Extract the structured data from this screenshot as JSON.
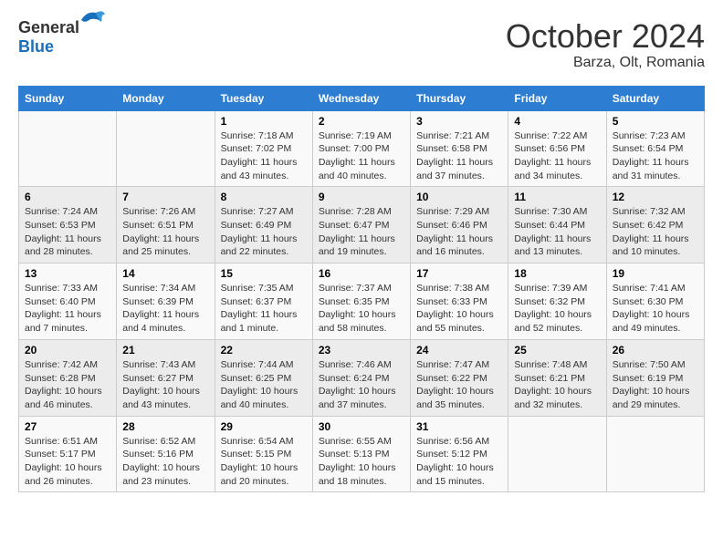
{
  "header": {
    "logo_general": "General",
    "logo_blue": "Blue",
    "month_year": "October 2024",
    "location": "Barza, Olt, Romania"
  },
  "days_of_week": [
    "Sunday",
    "Monday",
    "Tuesday",
    "Wednesday",
    "Thursday",
    "Friday",
    "Saturday"
  ],
  "weeks": [
    [
      {
        "day": "",
        "detail": ""
      },
      {
        "day": "",
        "detail": ""
      },
      {
        "day": "1",
        "detail": "Sunrise: 7:18 AM\nSunset: 7:02 PM\nDaylight: 11 hours and 43 minutes."
      },
      {
        "day": "2",
        "detail": "Sunrise: 7:19 AM\nSunset: 7:00 PM\nDaylight: 11 hours and 40 minutes."
      },
      {
        "day": "3",
        "detail": "Sunrise: 7:21 AM\nSunset: 6:58 PM\nDaylight: 11 hours and 37 minutes."
      },
      {
        "day": "4",
        "detail": "Sunrise: 7:22 AM\nSunset: 6:56 PM\nDaylight: 11 hours and 34 minutes."
      },
      {
        "day": "5",
        "detail": "Sunrise: 7:23 AM\nSunset: 6:54 PM\nDaylight: 11 hours and 31 minutes."
      }
    ],
    [
      {
        "day": "6",
        "detail": "Sunrise: 7:24 AM\nSunset: 6:53 PM\nDaylight: 11 hours and 28 minutes."
      },
      {
        "day": "7",
        "detail": "Sunrise: 7:26 AM\nSunset: 6:51 PM\nDaylight: 11 hours and 25 minutes."
      },
      {
        "day": "8",
        "detail": "Sunrise: 7:27 AM\nSunset: 6:49 PM\nDaylight: 11 hours and 22 minutes."
      },
      {
        "day": "9",
        "detail": "Sunrise: 7:28 AM\nSunset: 6:47 PM\nDaylight: 11 hours and 19 minutes."
      },
      {
        "day": "10",
        "detail": "Sunrise: 7:29 AM\nSunset: 6:46 PM\nDaylight: 11 hours and 16 minutes."
      },
      {
        "day": "11",
        "detail": "Sunrise: 7:30 AM\nSunset: 6:44 PM\nDaylight: 11 hours and 13 minutes."
      },
      {
        "day": "12",
        "detail": "Sunrise: 7:32 AM\nSunset: 6:42 PM\nDaylight: 11 hours and 10 minutes."
      }
    ],
    [
      {
        "day": "13",
        "detail": "Sunrise: 7:33 AM\nSunset: 6:40 PM\nDaylight: 11 hours and 7 minutes."
      },
      {
        "day": "14",
        "detail": "Sunrise: 7:34 AM\nSunset: 6:39 PM\nDaylight: 11 hours and 4 minutes."
      },
      {
        "day": "15",
        "detail": "Sunrise: 7:35 AM\nSunset: 6:37 PM\nDaylight: 11 hours and 1 minute."
      },
      {
        "day": "16",
        "detail": "Sunrise: 7:37 AM\nSunset: 6:35 PM\nDaylight: 10 hours and 58 minutes."
      },
      {
        "day": "17",
        "detail": "Sunrise: 7:38 AM\nSunset: 6:33 PM\nDaylight: 10 hours and 55 minutes."
      },
      {
        "day": "18",
        "detail": "Sunrise: 7:39 AM\nSunset: 6:32 PM\nDaylight: 10 hours and 52 minutes."
      },
      {
        "day": "19",
        "detail": "Sunrise: 7:41 AM\nSunset: 6:30 PM\nDaylight: 10 hours and 49 minutes."
      }
    ],
    [
      {
        "day": "20",
        "detail": "Sunrise: 7:42 AM\nSunset: 6:28 PM\nDaylight: 10 hours and 46 minutes."
      },
      {
        "day": "21",
        "detail": "Sunrise: 7:43 AM\nSunset: 6:27 PM\nDaylight: 10 hours and 43 minutes."
      },
      {
        "day": "22",
        "detail": "Sunrise: 7:44 AM\nSunset: 6:25 PM\nDaylight: 10 hours and 40 minutes."
      },
      {
        "day": "23",
        "detail": "Sunrise: 7:46 AM\nSunset: 6:24 PM\nDaylight: 10 hours and 37 minutes."
      },
      {
        "day": "24",
        "detail": "Sunrise: 7:47 AM\nSunset: 6:22 PM\nDaylight: 10 hours and 35 minutes."
      },
      {
        "day": "25",
        "detail": "Sunrise: 7:48 AM\nSunset: 6:21 PM\nDaylight: 10 hours and 32 minutes."
      },
      {
        "day": "26",
        "detail": "Sunrise: 7:50 AM\nSunset: 6:19 PM\nDaylight: 10 hours and 29 minutes."
      }
    ],
    [
      {
        "day": "27",
        "detail": "Sunrise: 6:51 AM\nSunset: 5:17 PM\nDaylight: 10 hours and 26 minutes."
      },
      {
        "day": "28",
        "detail": "Sunrise: 6:52 AM\nSunset: 5:16 PM\nDaylight: 10 hours and 23 minutes."
      },
      {
        "day": "29",
        "detail": "Sunrise: 6:54 AM\nSunset: 5:15 PM\nDaylight: 10 hours and 20 minutes."
      },
      {
        "day": "30",
        "detail": "Sunrise: 6:55 AM\nSunset: 5:13 PM\nDaylight: 10 hours and 18 minutes."
      },
      {
        "day": "31",
        "detail": "Sunrise: 6:56 AM\nSunset: 5:12 PM\nDaylight: 10 hours and 15 minutes."
      },
      {
        "day": "",
        "detail": ""
      },
      {
        "day": "",
        "detail": ""
      }
    ]
  ]
}
